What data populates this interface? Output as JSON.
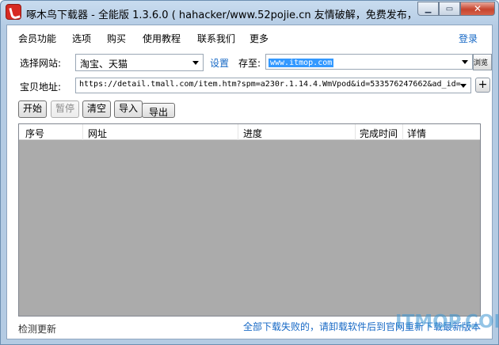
{
  "window": {
    "title": "啄木鸟下载器 - 全能版 1.3.6.0 ( hahacker/www.52pojie.cn 友情破解，免费发布，禁止...",
    "minimize_glyph": "▁",
    "maximize_glyph": "▭",
    "close_glyph": "✕"
  },
  "menu": {
    "items": [
      "会员功能",
      "选项",
      "购买",
      "使用教程",
      "联系我们",
      "更多"
    ],
    "login": "登录"
  },
  "form": {
    "site_label": "选择网站:",
    "site_value": "淘宝、天猫",
    "settings_link": "设置",
    "save_label": "存至:",
    "save_value": "www.itmop.com",
    "browse_label": "浏览",
    "url_label": "宝贝地址:",
    "url_value": "https://detail.tmall.com/item.htm?spm=a230r.1.14.4.WmVpod&id=533576247662&ad_id=",
    "add_url": "+"
  },
  "toolbar": {
    "start": "开始",
    "pause": "暂停",
    "clear": "清空",
    "import": "导入",
    "export": "导出"
  },
  "table": {
    "columns": [
      "序号",
      "网址",
      "进度",
      "完成时间",
      "详情"
    ]
  },
  "status": {
    "check_update": "检测更新",
    "notice": "全部下载失败的，请卸载软件后到官网重新下载最新版本",
    "watermark": "ITMOP.COM"
  },
  "colors": {
    "link": "#1668c5",
    "list_background": "#ababab",
    "selection": "#3399ff",
    "close_button": "#c7442e"
  }
}
